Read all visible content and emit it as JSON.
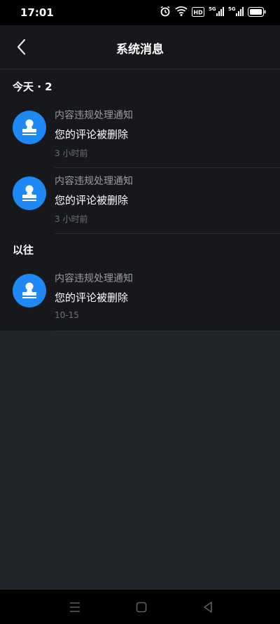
{
  "status_bar": {
    "time": "17:01",
    "icons": [
      "alarm-icon",
      "wifi-icon",
      "hd-icon",
      "signal-5g-icon",
      "signal-5g-icon",
      "battery-icon"
    ]
  },
  "header": {
    "title": "系统消息"
  },
  "sections": [
    {
      "title": "今天 · 2",
      "items": [
        {
          "title": "内容违规处理通知",
          "text": "您的评论被删除",
          "time": "3 小时前"
        },
        {
          "title": "内容违规处理通知",
          "text": "您的评论被删除",
          "time": "3 小时前"
        }
      ]
    },
    {
      "title": "以往",
      "items": [
        {
          "title": "内容违规处理通知",
          "text": "您的评论被删除",
          "time": "10-15"
        }
      ]
    }
  ],
  "colors": {
    "avatar_bg": "#1e88f5",
    "background": "#17181c",
    "page_background": "#22252a"
  }
}
